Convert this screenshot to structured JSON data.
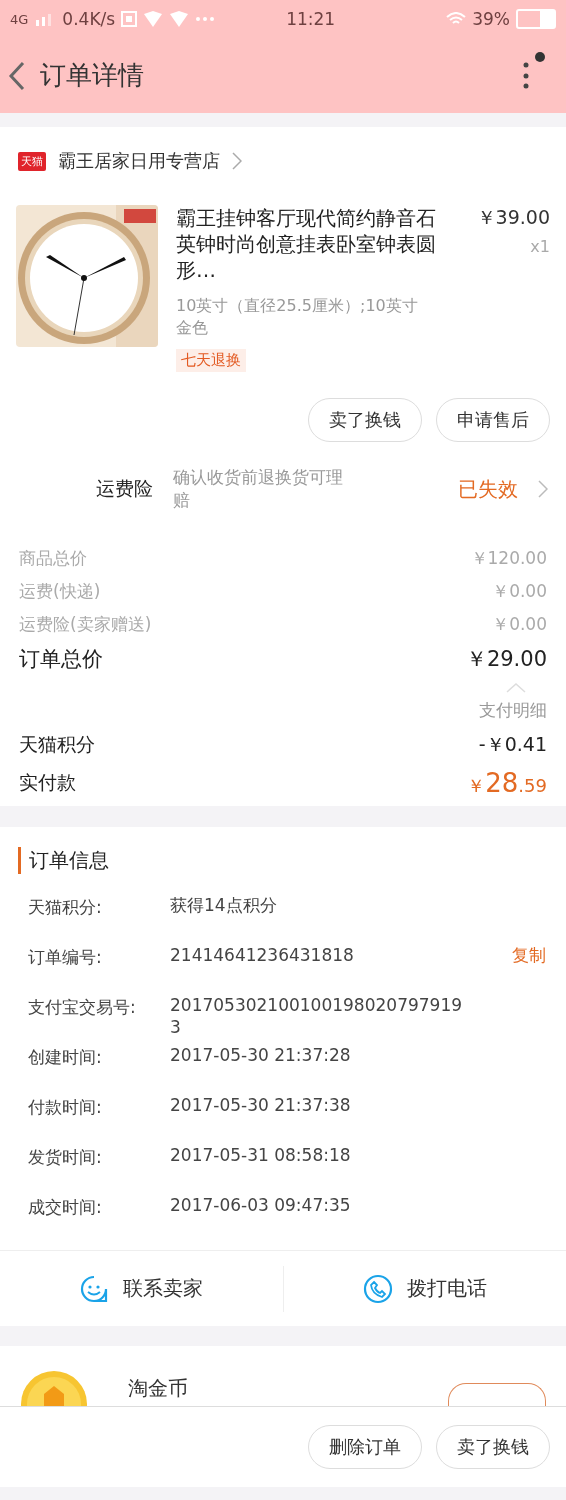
{
  "status_bar": {
    "network": "4G",
    "speed": "0.4K/s",
    "time": "11:21",
    "battery": "39%"
  },
  "nav": {
    "title": "订单详情"
  },
  "store": {
    "badge": "天猫",
    "name": "霸王居家日用专营店"
  },
  "item": {
    "title": "霸王挂钟客厅现代简约静音石英钟时尚创意挂表卧室钟表圆形…",
    "price": "￥39.00",
    "quantity": "x1",
    "sku": [
      "10英寸（直径25.5厘米）;10英寸",
      "金色"
    ],
    "tag": "七天退换"
  },
  "item_actions": [
    "卖了换钱",
    "申请售后"
  ],
  "insurance": {
    "label": "运费险",
    "description": "确认收货前退换货可理赔",
    "status": "已失效"
  },
  "price_rows": [
    {
      "kind": "minor",
      "label": "商品总价",
      "value": "￥120.00"
    },
    {
      "kind": "minor",
      "label": "运费(快递)",
      "value": "￥0.00"
    },
    {
      "kind": "minor",
      "label": "运费险(卖家赠送)",
      "value": "￥0.00"
    },
    {
      "kind": "total",
      "label": "订单总价",
      "value": "￥29.00"
    }
  ],
  "payment": {
    "detail_label": "支付明细",
    "points_label": "天猫积分",
    "points_value": "-￥0.41",
    "paid_label": "实付款",
    "paid_currency": "￥",
    "paid_integer": "28",
    "paid_decimal": ".59"
  },
  "order_info": {
    "title": "订单信息",
    "rows": [
      {
        "label": "天猫积分:",
        "value": "获得14点积分"
      },
      {
        "label": "订单编号:",
        "value": "21414641236431818",
        "action": "复制"
      },
      {
        "label": "支付宝交易号:",
        "value": "2017053021001001980207979193"
      },
      {
        "label": "创建时间:",
        "value": "2017-05-30 21:37:28"
      },
      {
        "label": "付款时间:",
        "value": "2017-05-30 21:37:38"
      },
      {
        "label": "发货时间:",
        "value": "2017-05-31 08:58:18"
      },
      {
        "label": "成交时间:",
        "value": "2017-06-03 09:47:35"
      }
    ]
  },
  "contact": [
    {
      "kind": "chat",
      "label": "联系卖家"
    },
    {
      "kind": "phone",
      "label": "拨打电话"
    }
  ],
  "coin": {
    "title": "淘金币"
  },
  "bottom_actions": [
    "删除订单",
    "卖了换钱"
  ]
}
